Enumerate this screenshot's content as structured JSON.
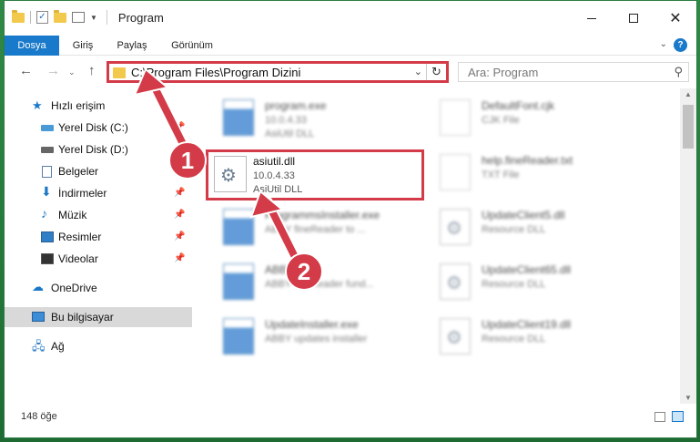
{
  "window": {
    "title": "Program",
    "minimize_glyph": "",
    "close_glyph": "✕"
  },
  "ribbon": {
    "tabs": [
      "Dosya",
      "Giriş",
      "Paylaş",
      "Görünüm"
    ],
    "help_glyph": "?"
  },
  "navigation": {
    "address": "C:\\Program Files\\Program Dizini",
    "search_placeholder": "Ara: Program"
  },
  "sidebar": {
    "items": [
      {
        "label": "Hızlı erişim",
        "icon": "star-icon"
      },
      {
        "label": "Yerel Disk (C:)",
        "icon": "drive-icon",
        "pinned": true
      },
      {
        "label": "Yerel Disk (D:)",
        "icon": "drive-icon",
        "pinned": true
      },
      {
        "label": "Belgeler",
        "icon": "document-icon",
        "pinned": true
      },
      {
        "label": "İndirmeler",
        "icon": "download-icon",
        "pinned": true
      },
      {
        "label": "Müzik",
        "icon": "music-icon",
        "pinned": true
      },
      {
        "label": "Resimler",
        "icon": "pictures-icon",
        "pinned": true
      },
      {
        "label": "Videolar",
        "icon": "videos-icon",
        "pinned": true
      },
      {
        "label": "OneDrive",
        "icon": "cloud-icon"
      },
      {
        "label": "Bu bilgisayar",
        "icon": "computer-icon",
        "selected": true
      },
      {
        "label": "Ağ",
        "icon": "network-icon"
      }
    ]
  },
  "files": {
    "highlighted": {
      "name": "asiutil.dll",
      "version": "10.0.4.33",
      "description": "AsiUtil DLL"
    },
    "background": [
      {
        "name": "program.exe",
        "version": "10.0.4.33",
        "description": "AsiUtil DLL"
      },
      {
        "name": "DefaultFont.cjk",
        "version": "",
        "description": "CJK File"
      },
      {
        "name": "help.fineReader.txt",
        "version": "",
        "description": "TXT File"
      },
      {
        "name": "ProgrammsInstaller.exe",
        "version": "",
        "description": "ABBY fineReader to ..."
      },
      {
        "name": "UpdateClient5.dll",
        "version": "",
        "description": "Resource DLL"
      },
      {
        "name": "ABBYY.exe",
        "version": "",
        "description": "ABBY fineReader fund..."
      },
      {
        "name": "UpdateClient65.dll",
        "version": "",
        "description": "Resource DLL"
      },
      {
        "name": "UpdateInstaller.exe",
        "version": "",
        "description": "ABBY updates installer"
      },
      {
        "name": "UpdateClient19.dll",
        "version": "",
        "description": "Resource DLL"
      }
    ]
  },
  "status": {
    "item_count": "148 öğe"
  },
  "annotations": {
    "badges": [
      "1",
      "2"
    ],
    "color": "#d33b48"
  }
}
